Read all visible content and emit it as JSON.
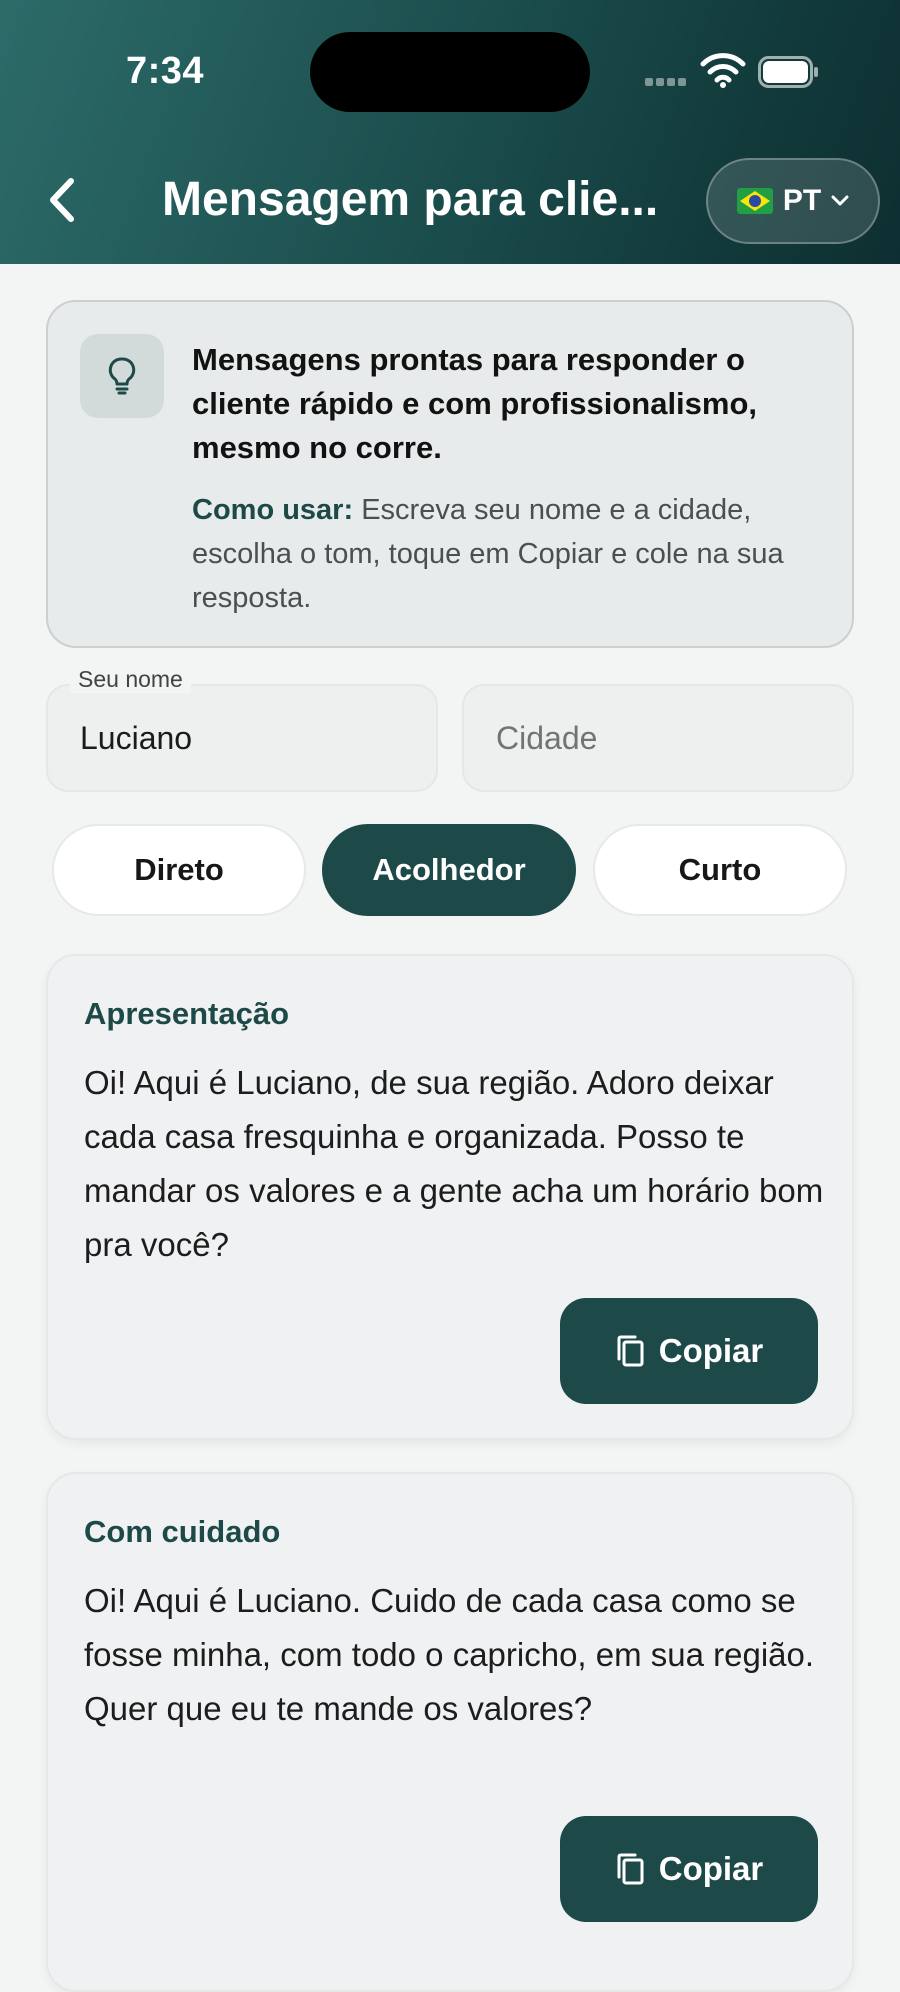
{
  "status_bar": {
    "time": "7:34"
  },
  "header": {
    "title": "Mensagem para clie...",
    "language": "PT"
  },
  "info": {
    "headline": "Mensagens prontas para responder o cliente rápido e com profissionalismo, mesmo no corre.",
    "howto_label": "Como usar:",
    "howto_text": "Escreva seu nome e a cidade, escolha o tom, toque em Copiar e cole na sua resposta."
  },
  "form": {
    "name_label": "Seu nome",
    "name_value": "Luciano",
    "city_placeholder": "Cidade",
    "city_value": ""
  },
  "tones": [
    {
      "label": "Direto",
      "selected": false
    },
    {
      "label": "Acolhedor",
      "selected": true
    },
    {
      "label": "Curto",
      "selected": false
    }
  ],
  "messages": [
    {
      "title": "Apresentação",
      "body": "Oi! Aqui é Luciano, de sua região. Adoro deixar cada casa fresquinha e organizada. Posso te mandar os valores e a gente acha um horário bom pra você?",
      "copy_label": "Copiar"
    },
    {
      "title": "Com cuidado",
      "body": "Oi! Aqui é Luciano. Cuido de cada casa como se fosse minha, com todo o capricho, em sua região. Quer que eu te mande os valores?",
      "copy_label": "Copiar"
    }
  ],
  "colors": {
    "brand": "#1d4a48",
    "header_start": "#2c6b69",
    "header_end": "#0e2f31",
    "background": "#f3f4f4"
  }
}
